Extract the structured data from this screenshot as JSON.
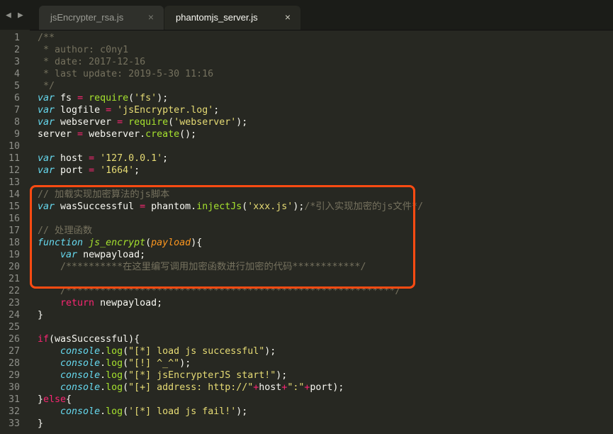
{
  "tabs": [
    {
      "label": "jsEncrypter_rsa.js",
      "active": false,
      "close": "×"
    },
    {
      "label": "phantomjs_server.js",
      "active": true,
      "close": "×"
    }
  ],
  "nav": {
    "back_icon": "◀",
    "forward_icon": "▶"
  },
  "line_numbers": [
    "1",
    "2",
    "3",
    "4",
    "5",
    "6",
    "7",
    "8",
    "9",
    "10",
    "11",
    "12",
    "13",
    "14",
    "15",
    "16",
    "17",
    "18",
    "19",
    "20",
    "21",
    "22",
    "23",
    "24",
    "25",
    "26",
    "27",
    "28",
    "29",
    "30",
    "31",
    "32",
    "33"
  ],
  "code_lines": [
    [
      "/**"
    ],
    [
      " * author: c0ny1"
    ],
    [
      " * date: 2017-12-16"
    ],
    [
      " * last update: 2019-5-30 11:16"
    ],
    [
      " */"
    ],
    [
      "var",
      " fs ",
      "=",
      " ",
      "require",
      "(",
      "'fs'",
      ");"
    ],
    [
      "var",
      " logfile ",
      "=",
      " ",
      "'jsEncrypter.log'",
      ";"
    ],
    [
      "var",
      " webserver ",
      "=",
      " ",
      "require",
      "(",
      "'webserver'",
      ");"
    ],
    [
      "server ",
      "=",
      " webserver.",
      "create",
      "();"
    ],
    [
      ""
    ],
    [
      "var",
      " host ",
      "=",
      " ",
      "'127.0.0.1'",
      ";"
    ],
    [
      "var",
      " port ",
      "=",
      " ",
      "'1664'",
      ";"
    ],
    [
      ""
    ],
    [
      "// 加载实现加密算法的js脚本"
    ],
    [
      "var",
      " wasSuccessful ",
      "=",
      " phantom.",
      "injectJs",
      "(",
      "'xxx.js'",
      ");",
      "/*引入实现加密的js文件*/"
    ],
    [
      ""
    ],
    [
      "// 处理函数"
    ],
    [
      "function",
      " ",
      "js_encrypt",
      "(",
      "payload",
      "){"
    ],
    [
      "    ",
      "var",
      " newpayload;"
    ],
    [
      "    ",
      "/**********在这里编写调用加密函数进行加密的代码************/"
    ],
    [
      ""
    ],
    [
      "    ",
      "/**********************************************************/"
    ],
    [
      "    ",
      "return",
      " newpayload;"
    ],
    [
      "}"
    ],
    [
      ""
    ],
    [
      "if",
      "(wasSuccessful){"
    ],
    [
      "    ",
      "console",
      ".",
      "log",
      "(",
      "\"[*] load js successful\"",
      ");"
    ],
    [
      "    ",
      "console",
      ".",
      "log",
      "(",
      "\"[!] ^_^\"",
      ");"
    ],
    [
      "    ",
      "console",
      ".",
      "log",
      "(",
      "\"[*] jsEncrypterJS start!\"",
      ");"
    ],
    [
      "    ",
      "console",
      ".",
      "log",
      "(",
      "\"[+] address: http://\"",
      "+",
      "host",
      "+",
      "\":\"",
      "+",
      "port);"
    ],
    [
      "}",
      "else",
      "{"
    ],
    [
      "    ",
      "console",
      ".",
      "log",
      "(",
      "'[*] load js fail!'",
      ");"
    ],
    [
      "}"
    ]
  ],
  "token_styles": [
    [
      "c"
    ],
    [
      "c"
    ],
    [
      "c"
    ],
    [
      "c"
    ],
    [
      "c"
    ],
    [
      "k",
      "",
      "o",
      "",
      "f",
      "",
      "s",
      ""
    ],
    [
      "k",
      "",
      "o",
      "",
      "s",
      ""
    ],
    [
      "k",
      "",
      "o",
      "",
      "f",
      "",
      "s",
      ""
    ],
    [
      "",
      "o",
      "",
      "f",
      ""
    ],
    [
      ""
    ],
    [
      "k",
      "",
      "o",
      "",
      "s",
      ""
    ],
    [
      "k",
      "",
      "o",
      "",
      "s",
      ""
    ],
    [
      ""
    ],
    [
      "c"
    ],
    [
      "k",
      "",
      "o",
      "",
      "f",
      "",
      "s",
      "",
      "c"
    ],
    [
      ""
    ],
    [
      "c"
    ],
    [
      "k",
      "",
      "fi",
      "",
      "a",
      ""
    ],
    [
      "",
      "k",
      ""
    ],
    [
      "",
      "c"
    ],
    [
      ""
    ],
    [
      "",
      "c"
    ],
    [
      "",
      "p",
      ""
    ],
    [
      ""
    ],
    [
      ""
    ],
    [
      "p",
      ""
    ],
    [
      "",
      "k",
      "",
      "f",
      "",
      "s",
      ""
    ],
    [
      "",
      "k",
      "",
      "f",
      "",
      "s",
      ""
    ],
    [
      "",
      "k",
      "",
      "f",
      "",
      "s",
      ""
    ],
    [
      "",
      "k",
      "",
      "f",
      "",
      "s",
      "o",
      "",
      "o",
      "s",
      "o",
      ""
    ],
    [
      "",
      "p",
      ""
    ],
    [
      "",
      "k",
      "",
      "f",
      "",
      "s",
      ""
    ],
    [
      ""
    ]
  ],
  "highlight_lines": {
    "start": 17,
    "end": 24
  }
}
